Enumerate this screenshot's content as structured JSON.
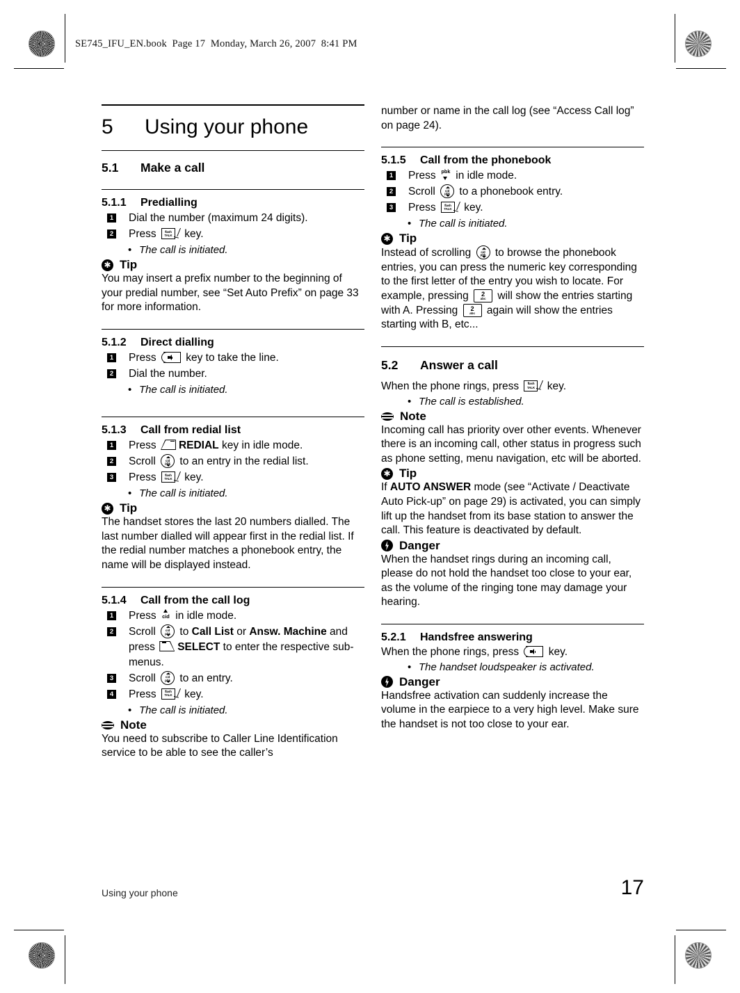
{
  "running_header": "SE745_IFU_EN.book  Page 17  Monday, March 26, 2007  8:41 PM",
  "chapter": {
    "number": "5",
    "title": "Using your phone"
  },
  "footer": {
    "left": "Using your phone",
    "page_number": "17"
  },
  "keys": {
    "talk": {
      "name": "flash-talk-key",
      "line1": "flash",
      "line2": "TALK"
    },
    "speaker": {
      "name": "speaker-key"
    },
    "redial_soft": {
      "name": "left-soft-key"
    },
    "select_soft": {
      "name": "right-soft-key"
    },
    "scroll": {
      "name": "scroll-key",
      "up_label": "cid",
      "down_label": "pbk"
    },
    "cid": {
      "name": "cid-key",
      "label": "cid"
    },
    "pbk": {
      "name": "pbk-key",
      "label": "pbk"
    },
    "num2": {
      "name": "numeric-key-2",
      "digit": "2",
      "letters": "abc"
    }
  },
  "callouts": {
    "tip": "Tip",
    "note": "Note",
    "danger": "Danger"
  },
  "left_column": {
    "section_5_1": {
      "number": "5.1",
      "title": "Make a call"
    },
    "s511": {
      "number": "5.1.1",
      "title": "Predialling",
      "steps": [
        {
          "n": "1",
          "pre": "Dial the number (maximum 24 digits).",
          "key": null,
          "post": ""
        },
        {
          "n": "2",
          "pre": "Press ",
          "key": "talk",
          "post": " key."
        }
      ],
      "bullets": [
        "The call is initiated."
      ],
      "tip_body": "You may insert a prefix number to the beginning of your predial number, see “Set Auto Prefix” on page 33 for more information."
    },
    "s512": {
      "number": "5.1.2",
      "title": "Direct dialling",
      "steps": [
        {
          "n": "1",
          "pre": "Press ",
          "key": "speaker",
          "post": " key to take the line."
        },
        {
          "n": "2",
          "pre": "Dial the number.",
          "key": null,
          "post": ""
        }
      ],
      "bullets": [
        "The call is initiated."
      ]
    },
    "s513": {
      "number": "5.1.3",
      "title": "Call from redial list",
      "step1_pre": "Press ",
      "step1_bold": "REDIAL",
      "step1_post": " key in idle mode.",
      "step2_pre": "Scroll ",
      "step2_post": " to an entry in the redial list.",
      "step3_pre": "Press ",
      "step3_post": " key.",
      "bullets": [
        "The call is initiated."
      ],
      "tip_body": "The handset stores the last 20 numbers dialled. The last number dialled will appear first in the redial list. If the redial number matches a phonebook entry, the name will be displayed instead."
    },
    "s514": {
      "number": "5.1.4",
      "title": "Call from the call log",
      "step1_pre": "Press ",
      "step1_post": " in idle mode.",
      "step2_pre": "Scroll ",
      "step2_mid1": " to ",
      "step2_bold1": "Call List",
      "step2_mid2": " or ",
      "step2_bold2": "Answ. Machine",
      "step2_mid3": " and press ",
      "step2_bold3": "SELECT",
      "step2_post": " to enter the respective sub-menus.",
      "step3_pre": "Scroll ",
      "step3_post": " to an entry.",
      "step4_pre": "Press ",
      "step4_post": " key.",
      "bullets": [
        "The call is initiated."
      ],
      "note_body": "You need to subscribe to Caller Line Identification service to be able to see the caller’s"
    }
  },
  "right_column": {
    "continuation": "number or name in the call log (see “Access Call log” on page 24).",
    "s515": {
      "number": "5.1.5",
      "title": "Call from the phonebook",
      "step1_pre": "Press ",
      "step1_post": " in idle mode.",
      "step2_pre": "Scroll ",
      "step2_post": " to a phonebook entry.",
      "step3_pre": "Press ",
      "step3_post": " key.",
      "bullets": [
        "The call is initiated."
      ],
      "tip_part1": "Instead of scrolling ",
      "tip_part2": " to browse the phonebook entries, you can press the numeric key corresponding to the first letter of the entry you wish to locate. For example, pressing ",
      "tip_part3": " will show the entries starting with A. Pressing ",
      "tip_part4": " again will show the entries starting with B, etc..."
    },
    "section_5_2": {
      "number": "5.2",
      "title": "Answer a call"
    },
    "s52": {
      "lead_pre": "When the phone rings, press ",
      "lead_post": " key.",
      "bullets": [
        "The call is established."
      ],
      "note_body": "Incoming call has priority over other events. Whenever there is an incoming call, other status in progress such as phone setting, menu navigation, etc will be aborted.",
      "tip_pre": "If ",
      "tip_bold": "AUTO ANSWER",
      "tip_post": " mode (see “Activate / Deactivate Auto Pick-up” on page 29) is activated, you can simply lift up the handset from its base station to answer the call. This feature is deactivated by default.",
      "danger_body": "When the handset rings during an incoming call, please do not hold the handset too close to your ear, as the volume of the ringing tone may damage your hearing."
    },
    "s521": {
      "number": "5.2.1",
      "title": "Handsfree answering",
      "lead_pre": "When the phone rings, press ",
      "lead_post": " key.",
      "bullets": [
        "The handset loudspeaker is activated."
      ],
      "danger_body": "Handsfree activation can suddenly increase the volume in the earpiece to a very high level. Make sure the handset is not too close to your ear."
    }
  }
}
